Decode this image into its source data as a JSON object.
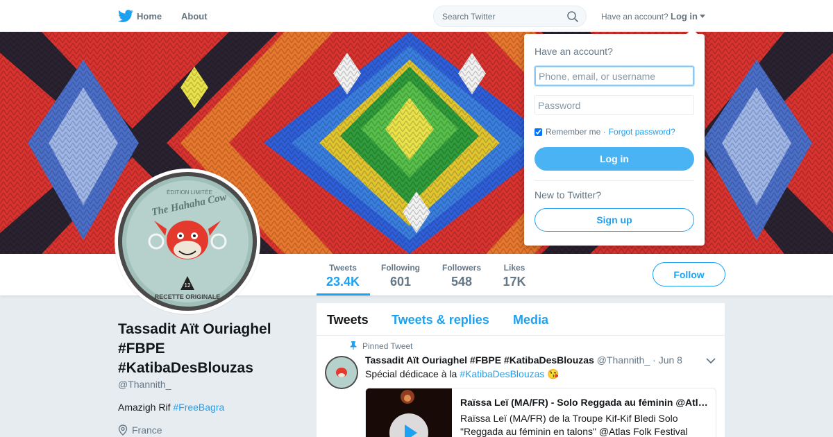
{
  "nav": {
    "home": "Home",
    "about": "About",
    "search_placeholder": "Search Twitter",
    "have_account": "Have an account?",
    "login": "Log in"
  },
  "profile": {
    "name": "Tassadit Aït Ouriaghel #FBPE #KatibaDesBlouzas",
    "handle": "@Thannith_",
    "bio_text": "Amazigh Rif ",
    "bio_tag": "#FreeBagra",
    "location": "France",
    "avatar_lines": {
      "top": "ÉDITION LIMITÉE",
      "brand": "The Hahaha Cow",
      "count": "12",
      "bottom": "RECETTE ORIGINALE"
    }
  },
  "stats": [
    {
      "label": "Tweets",
      "value": "23.4K"
    },
    {
      "label": "Following",
      "value": "601"
    },
    {
      "label": "Followers",
      "value": "548"
    },
    {
      "label": "Likes",
      "value": "17K"
    }
  ],
  "follow_label": "Follow",
  "tabs": [
    "Tweets",
    "Tweets & replies",
    "Media"
  ],
  "tweet": {
    "pinned_label": "Pinned Tweet",
    "author": "Tassadit Aït Ouriaghel #FBPE #KatibaDesBlouzas",
    "handle": "@Thannith_",
    "date": "Jun 8",
    "text": "Spécial dédicace à la ",
    "tag": "#KatibaDesBlouzas",
    "emoji": "😘",
    "card_title": "Raïssa Leï (MA/FR) - Solo Reggada au féminin @Atlas Folk Festival",
    "card_desc": "Raïssa Leï (MA/FR) de la Troupe Kif-Kif Bledi Solo \"Reggada au féminin en talons\" @Atlas Folk Festival"
  },
  "login_dropdown": {
    "title": "Have an account?",
    "username_placeholder": "Phone, email, or username",
    "password_placeholder": "Password",
    "remember": "Remember me",
    "forgot": "Forgot password?",
    "login_button": "Log in",
    "new_prompt": "New to Twitter?",
    "signup_button": "Sign up"
  },
  "colors": {
    "accent": "#1da1f2",
    "login_button": "#4ab3f4",
    "background": "#e6ecf0"
  },
  "icons": [
    "twitter-bird-icon",
    "search-icon",
    "caret-down-icon",
    "location-pin-icon",
    "pin-icon",
    "chevron-down-icon",
    "play-icon"
  ]
}
